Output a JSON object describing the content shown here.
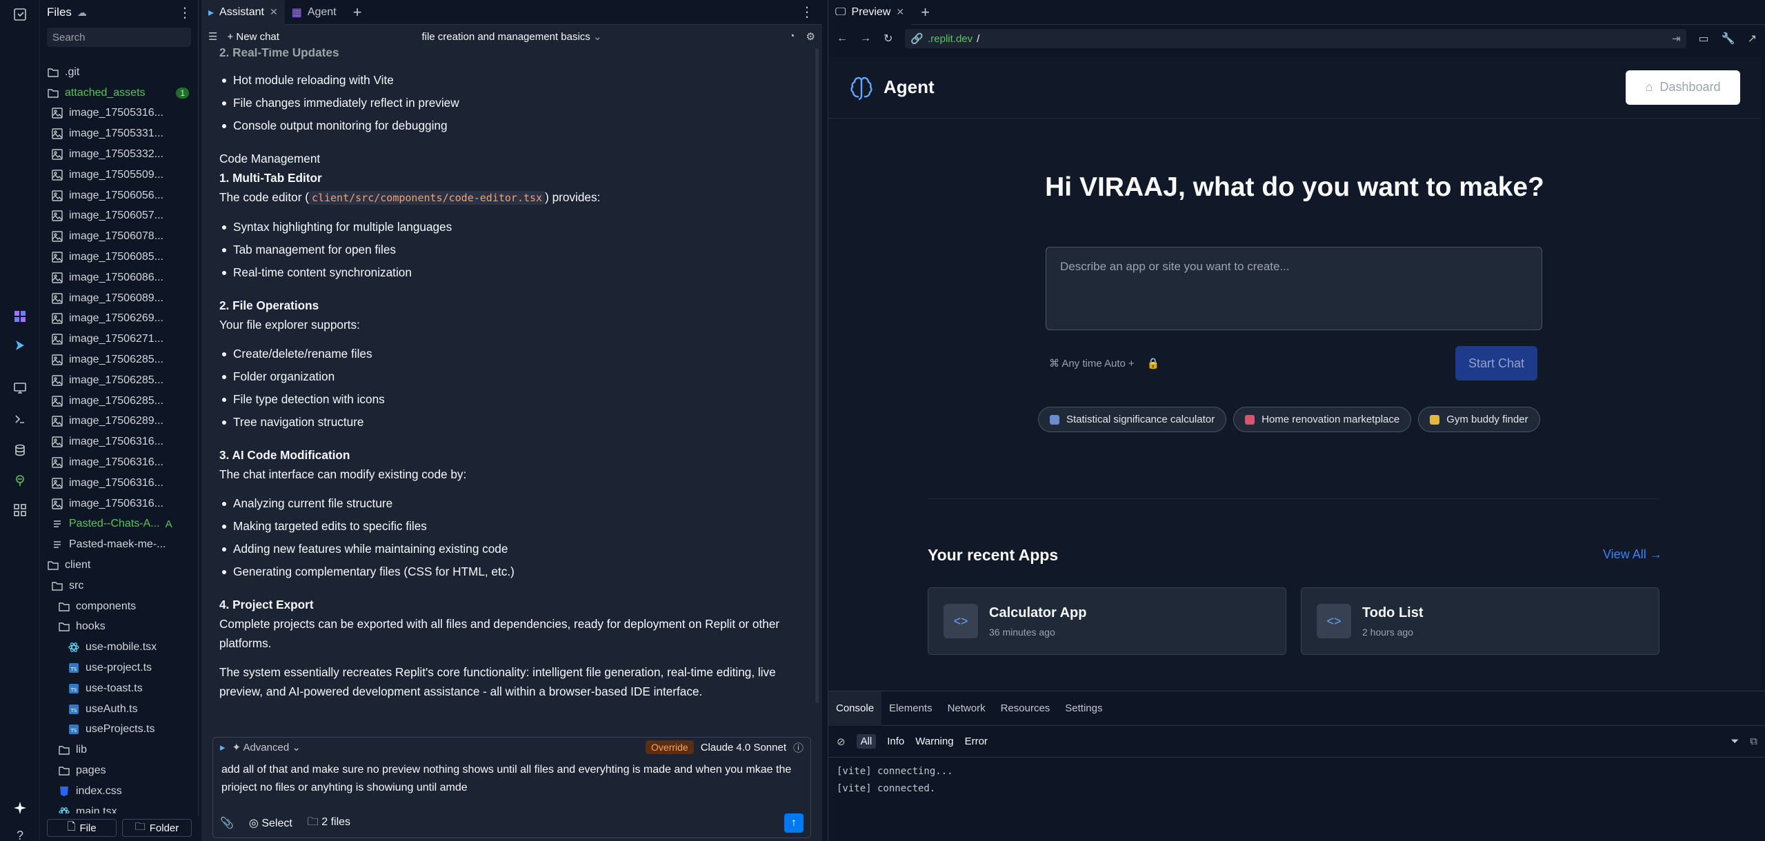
{
  "files_panel": {
    "title": "Files",
    "search_placeholder": "Search",
    "tree": [
      {
        "name": ".git",
        "type": "folder",
        "depth": 0
      },
      {
        "name": "attached_assets",
        "type": "folder",
        "depth": 0,
        "badge": "1",
        "green": true
      },
      {
        "name": "image_17505316...",
        "type": "image",
        "depth": 1
      },
      {
        "name": "image_17505331...",
        "type": "image",
        "depth": 1
      },
      {
        "name": "image_17505332...",
        "type": "image",
        "depth": 1
      },
      {
        "name": "image_17505509...",
        "type": "image",
        "depth": 1
      },
      {
        "name": "image_17506056...",
        "type": "image",
        "depth": 1
      },
      {
        "name": "image_17506057...",
        "type": "image",
        "depth": 1
      },
      {
        "name": "image_17506078...",
        "type": "image",
        "depth": 1
      },
      {
        "name": "image_17506085...",
        "type": "image",
        "depth": 1
      },
      {
        "name": "image_17506086...",
        "type": "image",
        "depth": 1
      },
      {
        "name": "image_17506089...",
        "type": "image",
        "depth": 1
      },
      {
        "name": "image_17506269...",
        "type": "image",
        "depth": 1
      },
      {
        "name": "image_17506271...",
        "type": "image",
        "depth": 1
      },
      {
        "name": "image_17506285...",
        "type": "image",
        "depth": 1
      },
      {
        "name": "image_17506285...",
        "type": "image",
        "depth": 1
      },
      {
        "name": "image_17506285...",
        "type": "image",
        "depth": 1
      },
      {
        "name": "image_17506289...",
        "type": "image",
        "depth": 1
      },
      {
        "name": "image_17506316...",
        "type": "image",
        "depth": 1
      },
      {
        "name": "image_17506316...",
        "type": "image",
        "depth": 1
      },
      {
        "name": "image_17506316...",
        "type": "image",
        "depth": 1
      },
      {
        "name": "image_17506316...",
        "type": "image",
        "depth": 1
      },
      {
        "name": "Pasted--Chats-A...",
        "type": "text",
        "depth": 1,
        "green": true,
        "git": "A"
      },
      {
        "name": "Pasted-maek-me-...",
        "type": "text",
        "depth": 1
      },
      {
        "name": "client",
        "type": "folder",
        "depth": 0
      },
      {
        "name": "src",
        "type": "folder",
        "depth": 1
      },
      {
        "name": "components",
        "type": "folder",
        "depth": 2
      },
      {
        "name": "hooks",
        "type": "folder",
        "depth": 2
      },
      {
        "name": "use-mobile.tsx",
        "type": "react",
        "depth": 3
      },
      {
        "name": "use-project.ts",
        "type": "ts",
        "depth": 3
      },
      {
        "name": "use-toast.ts",
        "type": "ts",
        "depth": 3
      },
      {
        "name": "useAuth.ts",
        "type": "ts",
        "depth": 3
      },
      {
        "name": "useProjects.ts",
        "type": "ts",
        "depth": 3
      },
      {
        "name": "lib",
        "type": "folder",
        "depth": 2
      },
      {
        "name": "pages",
        "type": "folder",
        "depth": 2
      },
      {
        "name": "index.css",
        "type": "css",
        "depth": 2
      },
      {
        "name": "main.tsx",
        "type": "react",
        "depth": 2
      }
    ],
    "file_button": "File",
    "folder_button": "Folder"
  },
  "assistant": {
    "tabs": [
      {
        "label": "Assistant",
        "active": true
      },
      {
        "label": "Agent",
        "active": false
      }
    ],
    "new_chat": "New chat",
    "chat_title": "file creation and management basics",
    "message": {
      "faded_heading": "2. Real-Time Updates",
      "list1": [
        "Hot module reloading with Vite",
        "File changes immediately reflect in preview",
        "Console output monitoring for debugging"
      ],
      "section": "Code Management",
      "h1": "1. Multi-Tab Editor",
      "p1_before": "The code editor (",
      "p1_code": "client/src/components/code-editor.tsx",
      "p1_after": ") provides:",
      "list2": [
        "Syntax highlighting for multiple languages",
        "Tab management for open files",
        "Real-time content synchronization"
      ],
      "h2": "2. File Operations",
      "p2": "Your file explorer supports:",
      "list3": [
        "Create/delete/rename files",
        "Folder organization",
        "File type detection with icons",
        "Tree navigation structure"
      ],
      "h3": "3. AI Code Modification",
      "p3": "The chat interface can modify existing code by:",
      "list4": [
        "Analyzing current file structure",
        "Making targeted edits to specific files",
        "Adding new features while maintaining existing code",
        "Generating complementary files (CSS for HTML, etc.)"
      ],
      "h4": "4. Project Export",
      "p4": "Complete projects can be exported with all files and dependencies, ready for deployment on Replit or other platforms.",
      "p5": "The system essentially recreates Replit's core functionality: intelligent file generation, real-time editing, live preview, and AI-powered development assistance - all within a browser-based IDE interface."
    },
    "composer": {
      "mode": "Advanced",
      "override": "Override",
      "model": "Claude 4.0 Sonnet",
      "text": "add all of that and make sure no preview nothing shows until all files and everyhting is made and when you mkae the prioject no files or anyhting is showiung until amde",
      "select_label": "Select",
      "files_label": "2 files"
    }
  },
  "preview": {
    "tab_label": "Preview",
    "url_domain": ".replit.dev",
    "url_path": "/",
    "site": {
      "brand": "Agent",
      "dashboard_button": "Dashboard",
      "heading": "Hi VIRAAJ, what do you want to make?",
      "prompt_placeholder": "Describe an app or site you want to create...",
      "options": "⌘ Any time Auto +",
      "start_button": "Start Chat",
      "chips": [
        {
          "label": "Statistical significance calculator",
          "color": "#6b8cce"
        },
        {
          "label": "Home renovation marketplace",
          "color": "#d9546e"
        },
        {
          "label": "Gym buddy finder",
          "color": "#e5b541"
        }
      ],
      "recent_title": "Your recent Apps",
      "view_all": "View All →",
      "apps": [
        {
          "name": "Calculator App",
          "time": "36 minutes ago"
        },
        {
          "name": "Todo List",
          "time": "2 hours ago"
        }
      ]
    },
    "devtools": {
      "tabs": [
        "Console",
        "Elements",
        "Network",
        "Resources",
        "Settings"
      ],
      "filters": [
        "All",
        "Info",
        "Warning",
        "Error"
      ],
      "logs": [
        "[vite] connecting...",
        "[vite] connected."
      ]
    }
  },
  "colors": {
    "accent": "#0079f2",
    "green": "#58c65d",
    "background": "#0e1525",
    "surface": "#1c2333"
  }
}
